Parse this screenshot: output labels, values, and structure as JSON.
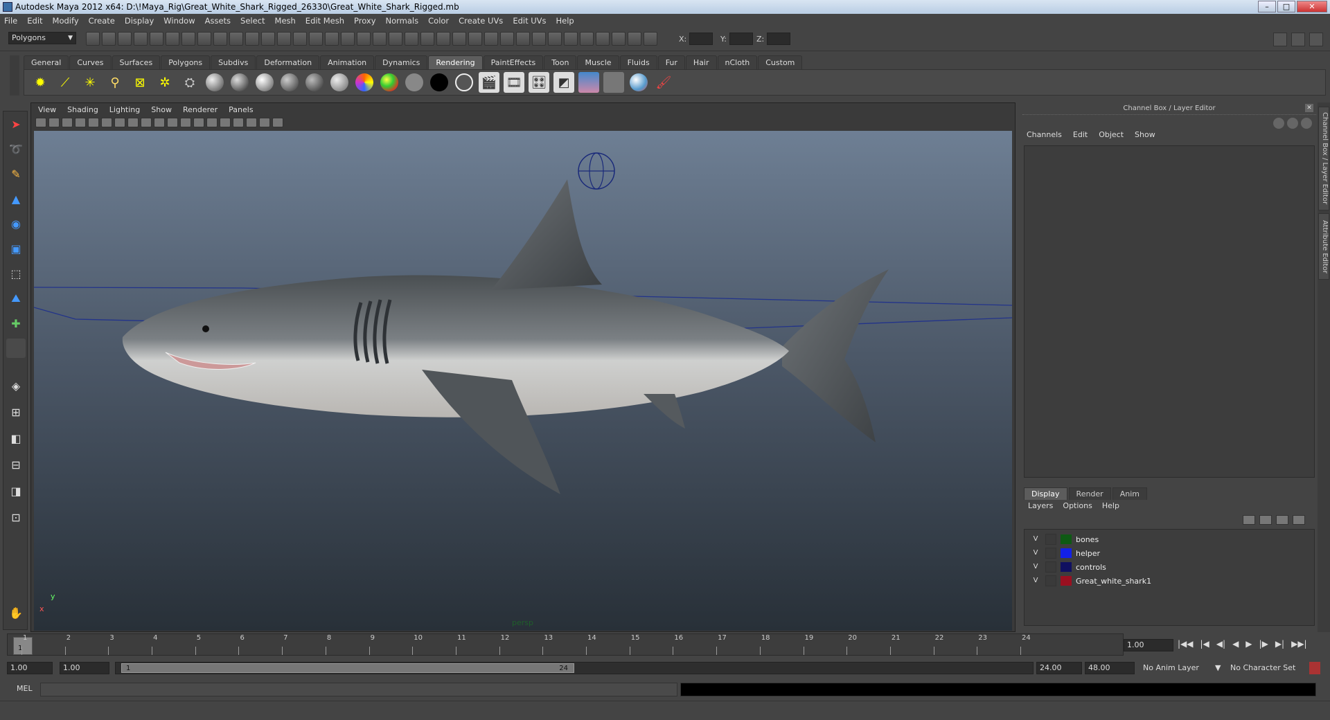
{
  "window": {
    "title": "Autodesk Maya 2012 x64: D:\\!Maya_Rig\\Great_White_Shark_Rigged_26330\\Great_White_Shark_Rigged.mb",
    "minimize": "–",
    "maximize": "□",
    "close": "✕"
  },
  "menubar": [
    "File",
    "Edit",
    "Modify",
    "Create",
    "Display",
    "Window",
    "Assets",
    "Select",
    "Mesh",
    "Edit Mesh",
    "Proxy",
    "Normals",
    "Color",
    "Create UVs",
    "Edit UVs",
    "Help"
  ],
  "statusline": {
    "mode": "Polygons",
    "x_label": "X:",
    "y_label": "Y:",
    "z_label": "Z:"
  },
  "shelf_tabs": [
    "General",
    "Curves",
    "Surfaces",
    "Polygons",
    "Subdivs",
    "Deformation",
    "Animation",
    "Dynamics",
    "Rendering",
    "PaintEffects",
    "Toon",
    "Muscle",
    "Fluids",
    "Fur",
    "Hair",
    "nCloth",
    "Custom"
  ],
  "active_shelf_tab": "Rendering",
  "viewport": {
    "menu": [
      "View",
      "Shading",
      "Lighting",
      "Show",
      "Renderer",
      "Panels"
    ],
    "camera_label": "persp",
    "axis_y": "y",
    "axis_x": "x"
  },
  "channel_box": {
    "title": "Channel Box / Layer Editor",
    "menu": [
      "Channels",
      "Edit",
      "Object",
      "Show"
    ]
  },
  "layer_editor": {
    "tabs": [
      "Display",
      "Render",
      "Anim"
    ],
    "active_tab": "Display",
    "menu": [
      "Layers",
      "Options",
      "Help"
    ],
    "layers": [
      {
        "visible": "V",
        "name": "bones",
        "color": "#0e5a14"
      },
      {
        "visible": "V",
        "name": "helper",
        "color": "#1220e8"
      },
      {
        "visible": "V",
        "name": "controls",
        "color": "#101060"
      },
      {
        "visible": "V",
        "name": "Great_white_shark1",
        "color": "#9a1020"
      }
    ]
  },
  "side_tabs": [
    "Channel Box / Layer Editor",
    "Attribute Editor"
  ],
  "timeline": {
    "ticks": [
      "1",
      "2",
      "3",
      "4",
      "5",
      "6",
      "7",
      "8",
      "9",
      "10",
      "11",
      "12",
      "13",
      "14",
      "15",
      "16",
      "17",
      "18",
      "19",
      "20",
      "21",
      "22",
      "23",
      "24"
    ],
    "current_frame": "1",
    "current_time": "1.00",
    "playback_buttons": [
      "|◀◀",
      "|◀",
      "◀|",
      "◀",
      "▶",
      "|▶",
      "▶|",
      "▶▶|"
    ]
  },
  "range": {
    "start": "1.00",
    "playback_start": "1.00",
    "handle_start": "1",
    "handle_end": "24",
    "playback_end": "24.00",
    "end": "48.00",
    "anim_layer": "No Anim Layer",
    "character_set": "No Character Set"
  },
  "cmdline": {
    "label": "MEL"
  }
}
